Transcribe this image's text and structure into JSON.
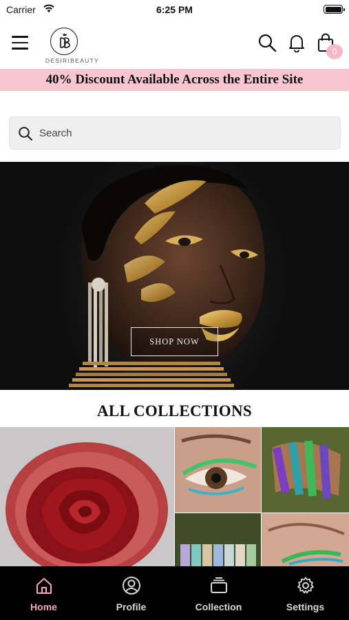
{
  "status_bar": {
    "carrier": "Carrier",
    "time": "6:25 PM"
  },
  "header": {
    "logo_text": "DESIRIBEAUTY",
    "cart_count": "0"
  },
  "promo": {
    "text": "40% Discount Available Across the Entire Site"
  },
  "search": {
    "placeholder": "Search"
  },
  "hero": {
    "button_label": "SHOP NOW"
  },
  "collections": {
    "title": "ALL COLLECTIONS"
  },
  "tabbar": {
    "active_color": "#f6a8bd",
    "items": [
      {
        "label": "Home",
        "icon": "home-icon"
      },
      {
        "label": "Profile",
        "icon": "profile-icon"
      },
      {
        "label": "Collection",
        "icon": "collection-icon"
      },
      {
        "label": "Settings",
        "icon": "settings-icon"
      }
    ]
  },
  "colors": {
    "promo_bg": "#f8c5d2",
    "badge": "#f6b8c7",
    "tabbar_bg": "#000000"
  }
}
